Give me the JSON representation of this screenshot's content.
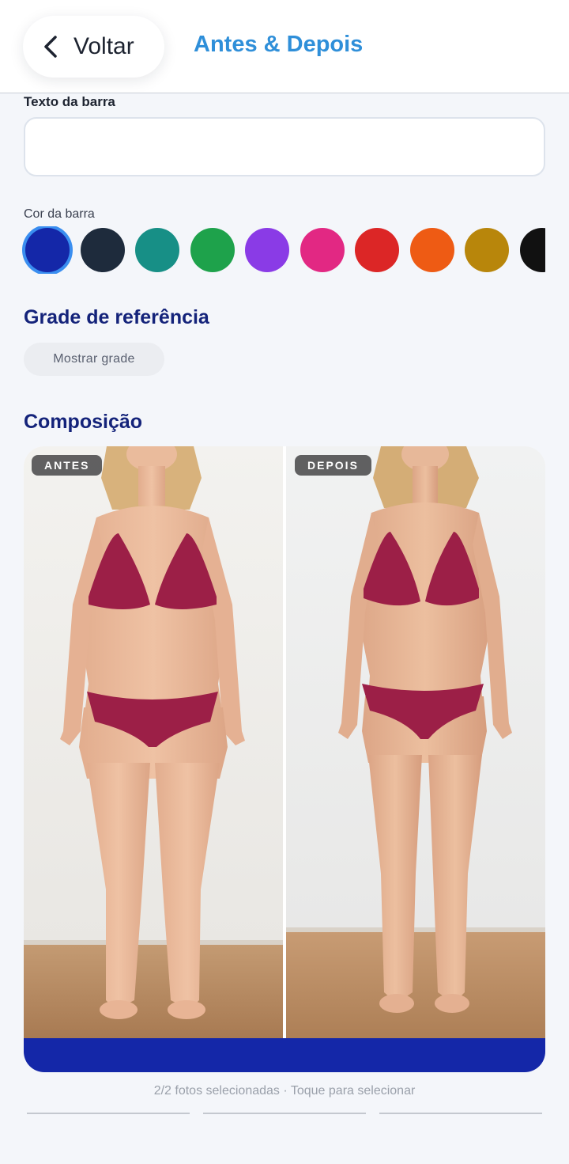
{
  "header": {
    "back_label": "Voltar",
    "title": "Antes & Depois"
  },
  "bar_text": {
    "label": "Texto da barra",
    "value": "",
    "placeholder": ""
  },
  "bar_color": {
    "label": "Cor da barra",
    "selected_index": 0,
    "swatches": [
      "#1427a8",
      "#1e2b3c",
      "#178f86",
      "#1ea24b",
      "#8a3be6",
      "#e22883",
      "#dc2626",
      "#ee5b14",
      "#b8860b",
      "#111111"
    ]
  },
  "reference_grid": {
    "title": "Grade de referência",
    "toggle_label": "Mostrar grade"
  },
  "composition": {
    "title": "Composição",
    "before_label": "ANTES",
    "after_label": "DEPOIS",
    "bar_color": "#1427a8"
  },
  "status": {
    "text": "2/2 fotos selecionadas · Toque para selecionar"
  }
}
